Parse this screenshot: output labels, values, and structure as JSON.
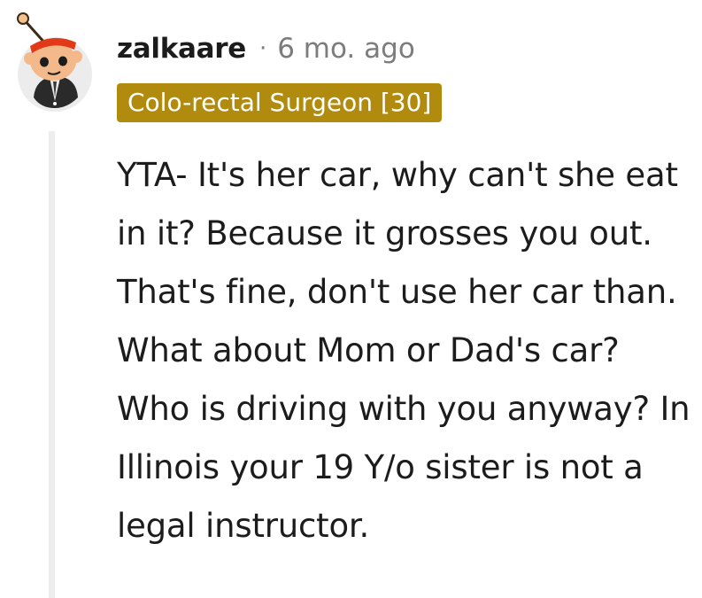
{
  "comment": {
    "username": "zalkaare",
    "separator": "·",
    "timestamp": "6 mo. ago",
    "flair": "Colo-rectal Surgeon [30]",
    "body": "YTA- It's her car, why can't she eat in it? Because it grosses you out. That's fine, don't use her car than. What about Mom or Dad's car? Who is driving with you anyway? In Illinois your 19 Y/o sister is not a legal instructor."
  },
  "colors": {
    "flair_background": "#b18b0e",
    "flair_text": "#ffffff",
    "username": "#1c1c1c",
    "timestamp": "#7c7c7c",
    "thread_line": "#ededed",
    "body_text": "#1c1c1c"
  },
  "icons": {
    "avatar": "snoo-avatar-icon"
  }
}
